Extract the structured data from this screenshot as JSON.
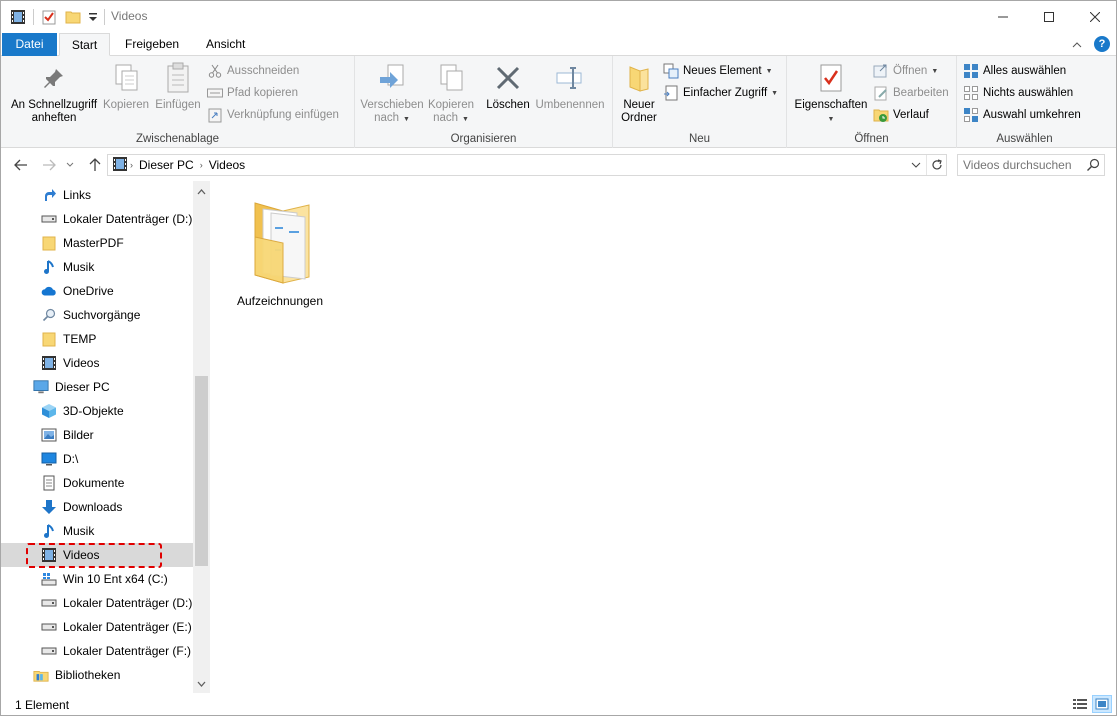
{
  "window": {
    "title": "Videos"
  },
  "tabs": {
    "file": "Datei",
    "start": "Start",
    "share": "Freigeben",
    "view": "Ansicht"
  },
  "ribbon": {
    "clipboard": {
      "label": "Zwischenablage",
      "pin_line1": "An Schnellzugriff",
      "pin_line2": "anheften",
      "copy": "Kopieren",
      "paste": "Einfügen",
      "cut": "Ausschneiden",
      "copy_path": "Pfad kopieren",
      "paste_shortcut": "Verknüpfung einfügen"
    },
    "organize": {
      "label": "Organisieren",
      "move_line1": "Verschieben",
      "move_line2": "nach",
      "copyto_line1": "Kopieren",
      "copyto_line2": "nach",
      "delete": "Löschen",
      "rename": "Umbenennen"
    },
    "new": {
      "label": "Neu",
      "folder_line1": "Neuer",
      "folder_line2": "Ordner",
      "new_item": "Neues Element",
      "easy_access": "Einfacher Zugriff"
    },
    "open": {
      "label": "Öffnen",
      "properties": "Eigenschaften",
      "open": "Öffnen",
      "edit": "Bearbeiten",
      "history": "Verlauf"
    },
    "select": {
      "label": "Auswählen",
      "select_all": "Alles auswählen",
      "select_none": "Nichts auswählen",
      "invert": "Auswahl umkehren"
    }
  },
  "address": {
    "crumbs": [
      "Dieser PC",
      "Videos"
    ]
  },
  "search": {
    "placeholder": "Videos durchsuchen"
  },
  "nav": {
    "items": [
      "Links",
      "Lokaler Datenträger (D:)",
      "MasterPDF",
      "Musik",
      "OneDrive",
      "Suchvorgänge",
      "TEMP",
      "Videos",
      "Dieser PC",
      "3D-Objekte",
      "Bilder",
      "D:\\",
      "Dokumente",
      "Downloads",
      "Musik",
      "Videos",
      "Win 10 Ent x64 (C:)",
      "Lokaler Datenträger (D:)",
      "Lokaler Datenträger (E:)",
      "Lokaler Datenträger (F:)",
      "Bibliotheken"
    ],
    "selected": "Videos"
  },
  "content": {
    "folders": [
      "Aufzeichnungen"
    ]
  },
  "status": {
    "count": "1 Element"
  },
  "colors": {
    "accent": "#1979ca",
    "highlight": "#e00000",
    "selected_bg": "#d9d9d9"
  }
}
